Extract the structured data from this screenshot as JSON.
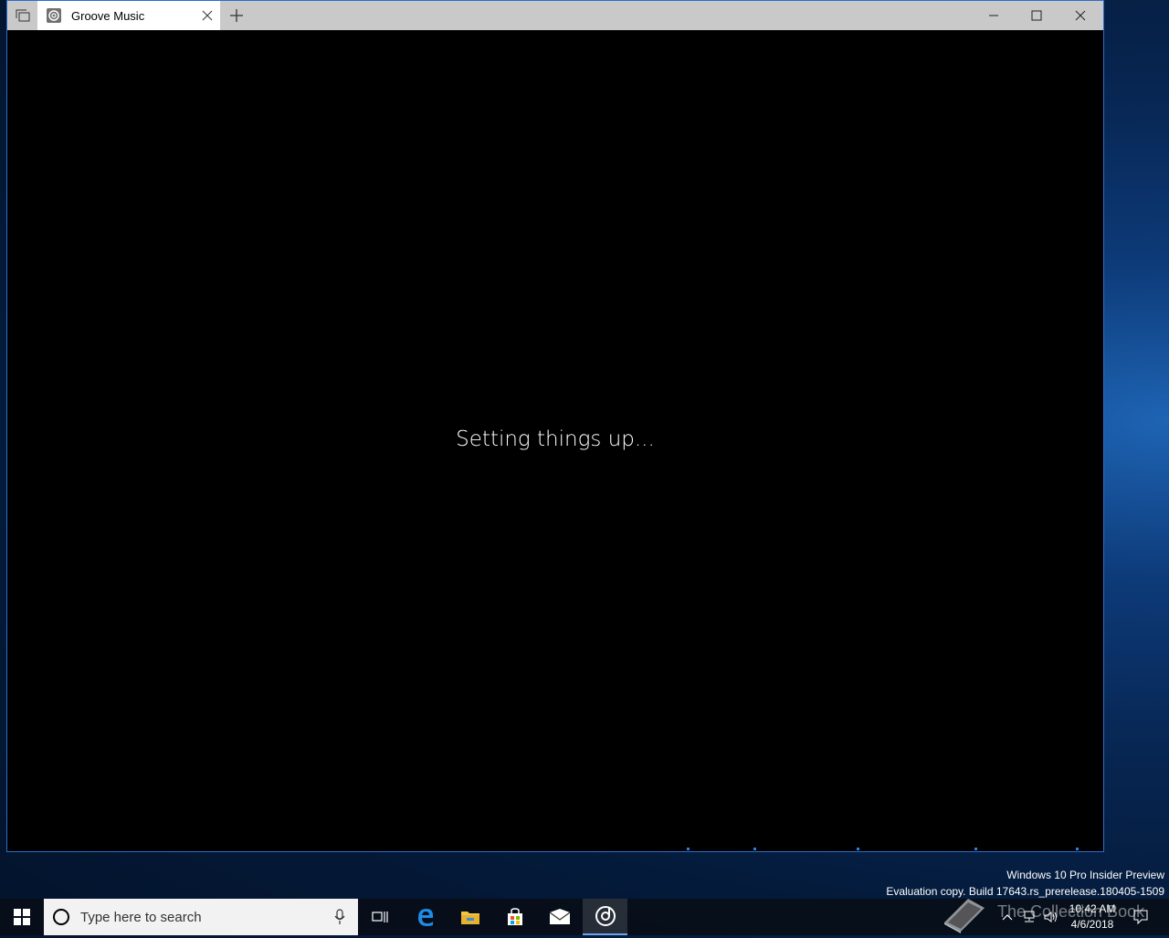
{
  "window": {
    "tab_title": "Groove Music",
    "loading_text": "Setting things up..."
  },
  "watermark": {
    "line1": "Windows 10 Pro Insider Preview",
    "line2": "Evaluation copy. Build 17643.rs_prerelease.180405-1509"
  },
  "taskbar": {
    "search_placeholder": "Type here to search",
    "overlay_text": "The Collection Book",
    "clock_time": "10:42 AM",
    "clock_date": "4/6/2018",
    "pinned_apps": [
      "task-view-icon",
      "edge-icon",
      "file-explorer-icon",
      "store-icon",
      "mail-icon",
      "groove-music-icon"
    ]
  },
  "colors": {
    "accent": "#2b6fc8",
    "titlebar": "#c9c9c9",
    "taskbar": "#080e18"
  }
}
